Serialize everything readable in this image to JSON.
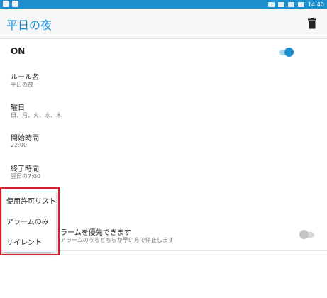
{
  "status_bar": {
    "time": "14:40"
  },
  "app_bar": {
    "title": "平日の夜"
  },
  "on_row": {
    "label": "ON",
    "toggle_on": true
  },
  "settings": [
    {
      "title": "ルール名",
      "value": "平日の夜"
    },
    {
      "title": "曜日",
      "value": "日、月、火、水、木"
    },
    {
      "title": "開始時間",
      "value": "22:00"
    },
    {
      "title": "終了時間",
      "value": "翌日の7:00"
    }
  ],
  "alarm_row": {
    "title_partial": "ラームを優先できます",
    "subtitle_partial": "アラームのうちどちらか早い方で停止します",
    "toggle_on": false
  },
  "popup_menu": {
    "items": [
      "使用許可リスト",
      "アラームのみ",
      "サイレント"
    ],
    "highlight_color": "#d2222d"
  },
  "colors": {
    "accent": "#1d8fd0",
    "status_bar": "#1c8fcf"
  }
}
